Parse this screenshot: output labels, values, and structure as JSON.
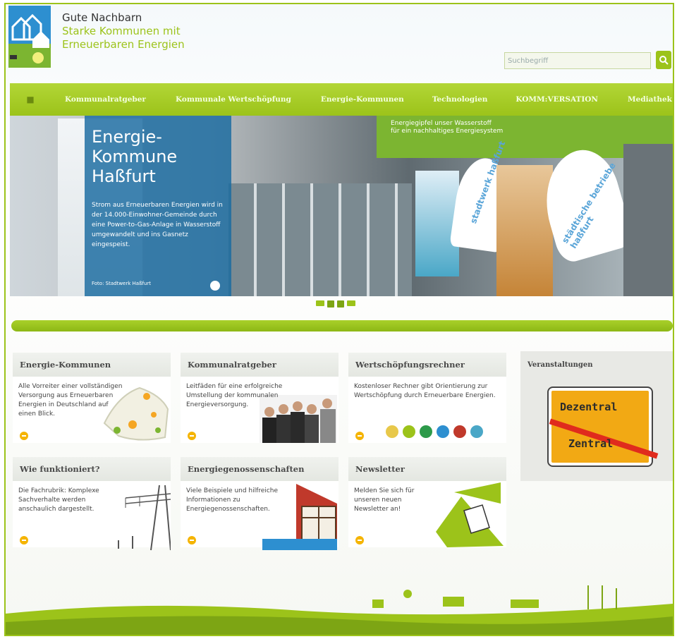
{
  "header": {
    "title_line1": "Gute Nachbarn",
    "title_line2": "Starke Kommunen mit",
    "title_line3": "Erneuerbaren Energien",
    "search_placeholder": "Suchbegriff",
    "accent_color": "#9cc31a"
  },
  "nav": {
    "items": [
      {
        "label": "Kommunalratgeber"
      },
      {
        "label": "Kommunale Wertschöpfung"
      },
      {
        "label": "Energie-Kommunen"
      },
      {
        "label": "Technologien"
      },
      {
        "label": "KOMM:VERSATION"
      },
      {
        "label": "Mediathek"
      }
    ]
  },
  "hero": {
    "headline": "Energie-\nKommune\nHaßfurt",
    "text": "Strom aus Erneuerbaren Energien wird in der 14.000-Einwohner-Gemeinde durch eine Power-to-Gas-Anlage in Wasserstoff umgewandelt und ins Gasnetz eingespeist.",
    "credit": "Foto: Stadtwerk Haßfurt",
    "flag1_text": "stadtwerk haßfurt",
    "flag2_text": "städtische betriebe haßfurt",
    "banner_text": "Energiegipfel unser Wasserstoff\nfür ein nachhaltiges Energiesystem",
    "slider_count": 4,
    "slider_active": 2
  },
  "cards": {
    "energie_kommunen": {
      "title": "Energie-Kommunen",
      "text": "Alle Vorreiter einer vollständigen Versorgung aus Erneuerbaren Energien in Deutschland auf einen Blick."
    },
    "kommunalratgeber": {
      "title": "Kommunalratgeber",
      "text": "Leitfäden für eine erfolgreiche Umstellung der kommunalen Energieversorgung."
    },
    "wertschoepfung": {
      "title": "Wertschöpfungsrechner",
      "text": "Kostenloser Rechner gibt Orientierung zur Wertschöpfung durch Erneuerbare Energien."
    },
    "wie": {
      "title": "Wie funktioniert?",
      "text": "Die Fachrubrik: Komplexe Sachverhalte werden anschaulich dargestellt."
    },
    "genossenschaften": {
      "title": "Energiegenossenschaften",
      "text": "Viele Beispiele und hilfreiche Informationen zu Energiegenossenschaften."
    },
    "newsletter": {
      "title": "Newsletter",
      "text": "Melden Sie sich für unseren neuen Newsletter an!"
    }
  },
  "veranstaltungen": {
    "title": "Veranstaltungen",
    "sign_top": "Dezentral",
    "sign_bottom": "Zentral"
  }
}
